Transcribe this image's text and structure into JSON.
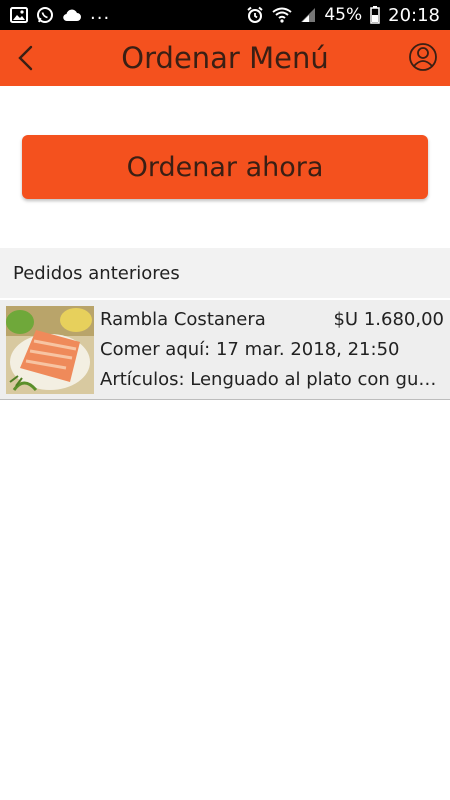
{
  "status_bar": {
    "left_icons": [
      "image-icon",
      "whatsapp-icon",
      "cloud-icon"
    ],
    "more": "...",
    "battery": "45%",
    "time": "20:18"
  },
  "app_bar": {
    "title": "Ordenar Menú",
    "back_icon": "chevron-left-icon",
    "profile_icon": "user-icon"
  },
  "order_button": {
    "label": "Ordenar ahora"
  },
  "section": {
    "title": "Pedidos anteriores"
  },
  "orders": [
    {
      "restaurant": "Rambla Costanera",
      "price": "$U 1.680,00",
      "type_date": "Comer aquí: 17 mar. 2018, 21:50",
      "items": "Artículos: Lenguado al plato con guar..."
    }
  ],
  "colors": {
    "accent": "#F4511E",
    "status_bar": "#000000",
    "section_bg": "#F2F2F2",
    "item_bg": "#EEEEEE"
  }
}
